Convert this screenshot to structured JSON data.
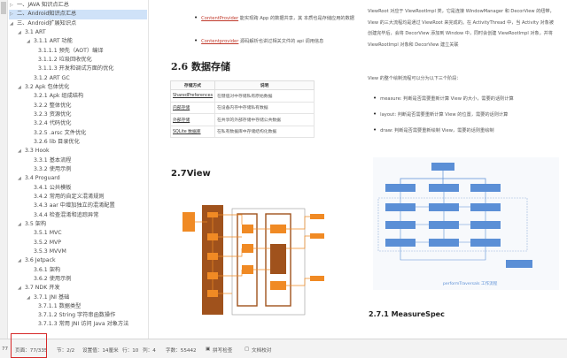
{
  "sidebar": {
    "items": [
      {
        "label": "一、JAVA 知识点汇总",
        "level": 0,
        "arrow": "▷"
      },
      {
        "label": "二、Android知识点汇总",
        "level": 0,
        "arrow": "▷",
        "active": true
      },
      {
        "label": "三、Android扩展知识点",
        "level": 0,
        "arrow": "◢"
      },
      {
        "label": "3.1 ART",
        "level": 1,
        "arrow": "◢"
      },
      {
        "label": "3.1.1 ART 功能",
        "level": 2,
        "arrow": "◢"
      },
      {
        "label": "3.1.1.1 预先（AOT）编译",
        "level": 3
      },
      {
        "label": "3.1.1.2 垃圾回收优化",
        "level": 3
      },
      {
        "label": "3.1.1.3 开发和调试方面的优化",
        "level": 3
      },
      {
        "label": "3.1.2 ART GC",
        "level": 2,
        "leaf": true
      },
      {
        "label": "3.2 Apk 包体优化",
        "level": 1,
        "arrow": "◢"
      },
      {
        "label": "3.2.1 Apk 组成结构",
        "level": 2,
        "leaf": true
      },
      {
        "label": "3.2.2 整体优化",
        "level": 2,
        "leaf": true
      },
      {
        "label": "3.2.3 资源优化",
        "level": 2,
        "leaf": true
      },
      {
        "label": "3.2.4 代码优化",
        "level": 2,
        "leaf": true
      },
      {
        "label": "3.2.5 .arsc 文件优化",
        "level": 2,
        "leaf": true
      },
      {
        "label": "3.2.6 lib 目录优化",
        "level": 2,
        "leaf": true
      },
      {
        "label": "3.3 Hook",
        "level": 1,
        "arrow": "◢"
      },
      {
        "label": "3.3.1 基本流程",
        "level": 2,
        "leaf": true
      },
      {
        "label": "3.3.2 使用示例",
        "level": 2,
        "leaf": true
      },
      {
        "label": "3.4 Proguard",
        "level": 1,
        "arrow": "◢"
      },
      {
        "label": "3.4.1 公共模板",
        "level": 2,
        "leaf": true
      },
      {
        "label": "3.4.2 常用的自定义混淆规则",
        "level": 2,
        "leaf": true
      },
      {
        "label": "3.4.3 aar 中增加独立的混淆配置",
        "level": 2,
        "leaf": true
      },
      {
        "label": "3.4.4 检查混淆和追踪异常",
        "level": 2,
        "leaf": true
      },
      {
        "label": "3.5 架构",
        "level": 1,
        "arrow": "◢"
      },
      {
        "label": "3.5.1 MVC",
        "level": 2,
        "leaf": true
      },
      {
        "label": "3.5.2 MVP",
        "level": 2,
        "leaf": true
      },
      {
        "label": "3.5.3 MVVM",
        "level": 2,
        "leaf": true
      },
      {
        "label": "3.6 Jetpack",
        "level": 1,
        "arrow": "◢"
      },
      {
        "label": "3.6.1 架构",
        "level": 2,
        "leaf": true
      },
      {
        "label": "3.6.2 使用示例",
        "level": 2,
        "leaf": true
      },
      {
        "label": "3.7 NDK 开发",
        "level": 1,
        "arrow": "◢"
      },
      {
        "label": "3.7.1 JNI 基础",
        "level": 2,
        "arrow": "◢"
      },
      {
        "label": "3.7.1.1 数据类型",
        "level": 3
      },
      {
        "label": "3.7.1.2 String 字符串函数操作",
        "level": 3
      },
      {
        "label": "3.7.1.3 常用 JNI 访问 Java 对象方法",
        "level": 3
      }
    ]
  },
  "doc": {
    "bullets": [
      {
        "link": "ContentProvider",
        "text": " 能实现跨 App 的数据共享，其 本质也是存储应用的数据"
      },
      {
        "link": "Contentprovider",
        "text": " 源码解析也讲过相关文件的 api 调用信息"
      }
    ],
    "heading_26": "2.6  数据存储",
    "table": {
      "headers": [
        "存储方式",
        "说明"
      ],
      "rows": [
        [
          "SharedPreferences",
          "在键值对中存储私有原始数据"
        ],
        [
          "内部存储",
          "在设备内存中存储私有数据"
        ],
        [
          "外部存储",
          "在共享的外部存储中存储公共数据"
        ],
        [
          "SQLite 数据库",
          "在私有数据库中存储结构化数据"
        ]
      ]
    },
    "heading_27": "2.7View",
    "heading_271": "2.7.1 MeasureSpec",
    "right_para": [
      "ViewRoot 对应于 ViewRootImpl 类，它是连接 WindowManager 和 DecorView 的纽带，",
      "View 的三大流程均是通过 ViewRoot 来完成的。在 ActivityThread 中，当 Activity 对象被",
      "创建完毕后，会将 DecorView 添加到 Window 中，同时会创建 ViewRootImpl 对象，并将",
      "ViewRootImpl 对象和 DecorView 建立关联"
    ],
    "right_intro": "View 的整个绘制流程可以分为以下三个阶段：",
    "right_bullets": [
      "measure: 判断是否需要重新计算 View 的大小，需要的话则计算",
      "layout: 判断是否需要重新计算 View 的位置，需要的话则计算",
      "draw: 判断是否需要重新绘制 View，需要的话则重绘制"
    ],
    "diagram_caption": "performTraversals 工作流程"
  },
  "status": {
    "line": "77",
    "page": "页面：77/335",
    "section": "节：2/2",
    "position": "设置值：14厘米",
    "row": "行：10",
    "col": "列：4",
    "words": "字数：55442",
    "spell": "拼写检查",
    "proof": "文档校对"
  },
  "colors": {
    "active": "#cfe2f8",
    "highlight_box": "#d62828",
    "flow_orange": "#f08a24",
    "flow_brown": "#a0521c",
    "flow_blue": "#5b8fd6"
  }
}
